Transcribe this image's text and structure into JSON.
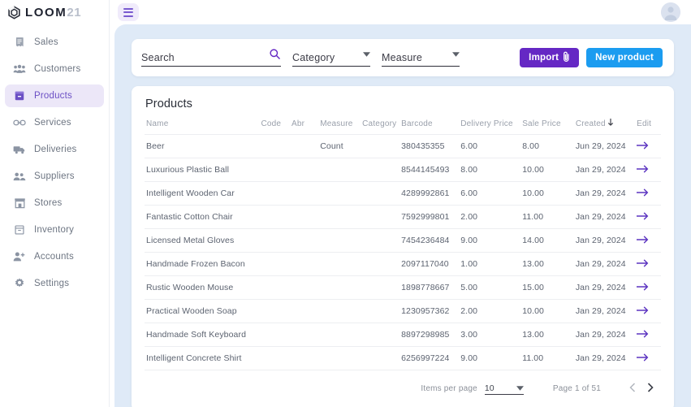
{
  "brand": {
    "name": "LOOM",
    "suffix": "21",
    "logo_icon": "hexagon-spiral-logo"
  },
  "topbar": {
    "menu_icon": "hamburger-menu-icon",
    "avatar_icon": "user-avatar-icon"
  },
  "sidebar": {
    "items": [
      {
        "label": "Sales",
        "icon": "receipt-icon",
        "active": false
      },
      {
        "label": "Customers",
        "icon": "people-group-icon",
        "active": false
      },
      {
        "label": "Products",
        "icon": "box-icon",
        "active": true
      },
      {
        "label": "Services",
        "icon": "link-chain-icon",
        "active": false
      },
      {
        "label": "Deliveries",
        "icon": "truck-icon",
        "active": false
      },
      {
        "label": "Suppliers",
        "icon": "people-icon",
        "active": false
      },
      {
        "label": "Stores",
        "icon": "storefront-icon",
        "active": false
      },
      {
        "label": "Inventory",
        "icon": "archive-box-icon",
        "active": false
      },
      {
        "label": "Accounts",
        "icon": "person-add-icon",
        "active": false
      },
      {
        "label": "Settings",
        "icon": "gear-icon",
        "active": false
      }
    ]
  },
  "filters": {
    "search": {
      "value": "",
      "placeholder": "Search",
      "icon": "search-icon"
    },
    "category": {
      "value": "Category",
      "icon": "chevron-down-icon"
    },
    "measure": {
      "value": "Measure",
      "icon": "chevron-down-icon"
    },
    "import_button": {
      "label": "Import",
      "icon": "paperclip-icon",
      "color": "#6528c4"
    },
    "new_product_button": {
      "label": "New product",
      "color": "#1b9cf0"
    }
  },
  "table": {
    "title": "Products",
    "sort_icon": "arrow-down-icon",
    "edit_icon": "arrow-right-icon",
    "columns": [
      "Name",
      "Code",
      "Abr",
      "Measure",
      "Category",
      "Barcode",
      "Delivery Price",
      "Sale Price",
      "Created",
      "Edit"
    ],
    "rows": [
      {
        "name": "Beer",
        "code": "",
        "abr": "",
        "measure": "Count",
        "category": "",
        "barcode": "380435355",
        "delivery_price": "6.00",
        "sale_price": "8.00",
        "created": "Jun 29, 2024"
      },
      {
        "name": "Luxurious Plastic Ball",
        "code": "",
        "abr": "",
        "measure": "",
        "category": "",
        "barcode": "8544145493",
        "delivery_price": "8.00",
        "sale_price": "10.00",
        "created": "Jan 29, 2024"
      },
      {
        "name": "Intelligent Wooden Car",
        "code": "",
        "abr": "",
        "measure": "",
        "category": "",
        "barcode": "4289992861",
        "delivery_price": "6.00",
        "sale_price": "10.00",
        "created": "Jan 29, 2024"
      },
      {
        "name": "Fantastic Cotton Chair",
        "code": "",
        "abr": "",
        "measure": "",
        "category": "",
        "barcode": "7592999801",
        "delivery_price": "2.00",
        "sale_price": "11.00",
        "created": "Jan 29, 2024"
      },
      {
        "name": "Licensed Metal Gloves",
        "code": "",
        "abr": "",
        "measure": "",
        "category": "",
        "barcode": "7454236484",
        "delivery_price": "9.00",
        "sale_price": "14.00",
        "created": "Jan 29, 2024"
      },
      {
        "name": "Handmade Frozen Bacon",
        "code": "",
        "abr": "",
        "measure": "",
        "category": "",
        "barcode": "2097117040",
        "delivery_price": "1.00",
        "sale_price": "13.00",
        "created": "Jan 29, 2024"
      },
      {
        "name": "Rustic Wooden Mouse",
        "code": "",
        "abr": "",
        "measure": "",
        "category": "",
        "barcode": "1898778667",
        "delivery_price": "5.00",
        "sale_price": "15.00",
        "created": "Jan 29, 2024"
      },
      {
        "name": "Practical Wooden Soap",
        "code": "",
        "abr": "",
        "measure": "",
        "category": "",
        "barcode": "1230957362",
        "delivery_price": "2.00",
        "sale_price": "10.00",
        "created": "Jan 29, 2024"
      },
      {
        "name": "Handmade Soft Keyboard",
        "code": "",
        "abr": "",
        "measure": "",
        "category": "",
        "barcode": "8897298985",
        "delivery_price": "3.00",
        "sale_price": "13.00",
        "created": "Jan 29, 2024"
      },
      {
        "name": "Intelligent Concrete Shirt",
        "code": "",
        "abr": "",
        "measure": "",
        "category": "",
        "barcode": "6256997224",
        "delivery_price": "9.00",
        "sale_price": "11.00",
        "created": "Jan 29, 2024"
      }
    ]
  },
  "pagination": {
    "items_per_page_label": "Items per page",
    "items_per_page_value": "10",
    "page_label": "Page 1 of 51",
    "prev_icon": "chevron-left-icon",
    "next_icon": "chevron-right-icon"
  },
  "colors": {
    "accent_purple": "#6528c4",
    "accent_blue": "#1b9cf0",
    "content_bg": "#dfeaf7",
    "active_nav_bg": "#ece7f8"
  }
}
